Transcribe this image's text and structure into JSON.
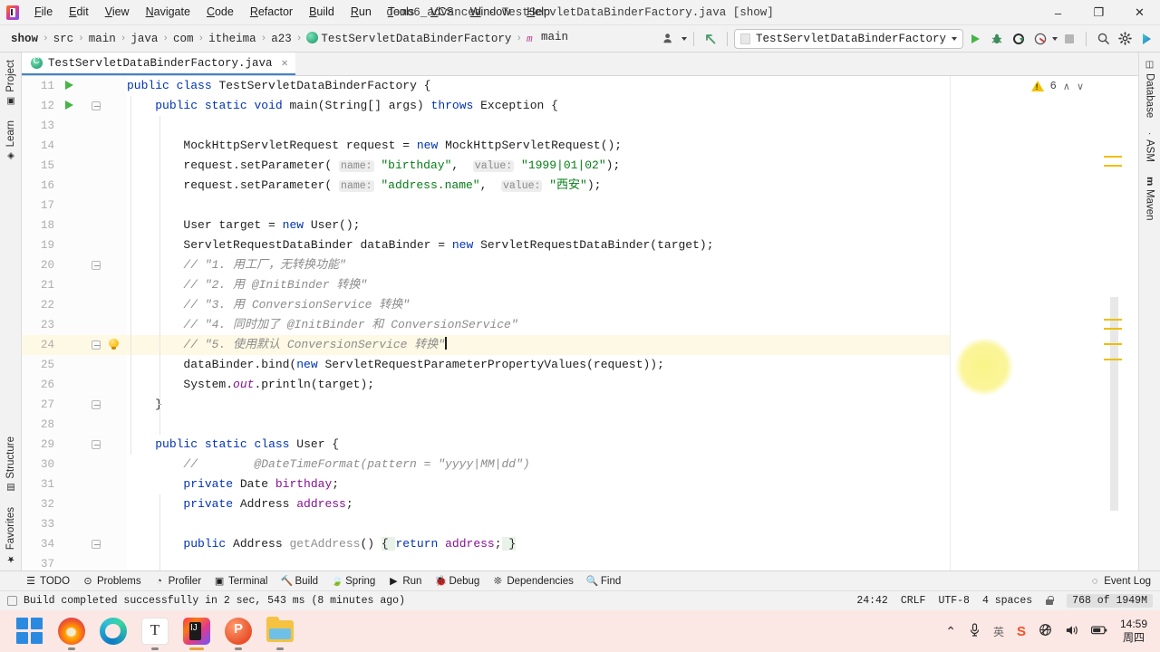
{
  "window": {
    "title": "demo6_advanced - TestServletDataBinderFactory.java [show]",
    "minimize_label": "–",
    "maximize_label": "❐",
    "close_label": "✕"
  },
  "menu": {
    "items": [
      {
        "label": "File"
      },
      {
        "label": "Edit"
      },
      {
        "label": "View"
      },
      {
        "label": "Navigate"
      },
      {
        "label": "Code"
      },
      {
        "label": "Refactor"
      },
      {
        "label": "Build"
      },
      {
        "label": "Run"
      },
      {
        "label": "Tools"
      },
      {
        "label": "VCS"
      },
      {
        "label": "Window"
      },
      {
        "label": "Help"
      }
    ]
  },
  "breadcrumb": {
    "items": [
      {
        "label": "show",
        "bold": true
      },
      {
        "label": "src",
        "bold": false
      },
      {
        "label": "main",
        "bold": false
      },
      {
        "label": "java",
        "bold": false
      },
      {
        "label": "com",
        "bold": false
      },
      {
        "label": "itheima",
        "bold": false
      },
      {
        "label": "a23",
        "bold": false
      },
      {
        "label": "TestServletDataBinderFactory",
        "bold": false
      },
      {
        "label": "main",
        "bold": false
      }
    ],
    "separator": "›"
  },
  "toolbar": {
    "run_config_label": "TestServletDataBinderFactory",
    "icons": {
      "profile_selector": "user-profile-icon",
      "updates": "arrow-up-left-icon",
      "run": "run-icon",
      "debug": "debug-icon",
      "run_coverage": "run-with-coverage-icon",
      "profiler": "profiler-icon",
      "stop": "stop-icon",
      "search_everywhere": "search-icon",
      "settings": "gear-icon",
      "ai_assistant": "ai-assistant-icon"
    }
  },
  "left_strip": {
    "top": [
      {
        "label": "Project",
        "icon": "project-icon"
      },
      {
        "label": "Learn",
        "icon": "learn-icon"
      }
    ],
    "bottom": [
      {
        "label": "Structure",
        "icon": "structure-icon"
      },
      {
        "label": "Favorites",
        "icon": "star-icon"
      }
    ]
  },
  "right_strip": {
    "items": [
      {
        "label": "Database",
        "icon": "database-icon"
      },
      {
        "label": "ASM",
        "icon": "asm-icon"
      },
      {
        "label": "Maven",
        "icon": "maven-icon"
      }
    ]
  },
  "editor_tab": {
    "filename": "TestServletDataBinderFactory.java",
    "close_label": "✕",
    "icon": "java-class-icon"
  },
  "inspections": {
    "warning_count": "6",
    "up_label": "∧",
    "down_label": "∨"
  },
  "code": {
    "first_line_number": 11,
    "lines": [
      {
        "n": 11,
        "indent": 0,
        "gutter": "run",
        "fold": false,
        "tokens": [
          {
            "t": "public",
            "c": "kw"
          },
          {
            "t": " ",
            "c": "plain"
          },
          {
            "t": "class",
            "c": "kw"
          },
          {
            "t": " TestServletDataBinderFactory {",
            "c": "plain"
          }
        ]
      },
      {
        "n": 12,
        "indent": 0,
        "gutter": "run",
        "fold": true,
        "tokens": [
          {
            "t": "    ",
            "c": "plain"
          },
          {
            "t": "public",
            "c": "kw"
          },
          {
            "t": " ",
            "c": "plain"
          },
          {
            "t": "static",
            "c": "kw"
          },
          {
            "t": " ",
            "c": "plain"
          },
          {
            "t": "void",
            "c": "kw"
          },
          {
            "t": " main(String[] args) ",
            "c": "plain"
          },
          {
            "t": "throws",
            "c": "kw"
          },
          {
            "t": " Exception {",
            "c": "plain"
          }
        ]
      },
      {
        "n": 13,
        "indent": 0,
        "gutter": "",
        "fold": false,
        "tokens": []
      },
      {
        "n": 14,
        "indent": 0,
        "gutter": "",
        "fold": false,
        "tokens": [
          {
            "t": "        MockHttpServletRequest request = ",
            "c": "plain"
          },
          {
            "t": "new",
            "c": "kw"
          },
          {
            "t": " MockHttpServletRequest();",
            "c": "plain"
          }
        ]
      },
      {
        "n": 15,
        "indent": 0,
        "gutter": "",
        "fold": false,
        "tokens": [
          {
            "t": "        request.setParameter( ",
            "c": "plain"
          },
          {
            "t": "name:",
            "c": "hint"
          },
          {
            "t": " ",
            "c": "plain"
          },
          {
            "t": "\"birthday\"",
            "c": "str"
          },
          {
            "t": ",  ",
            "c": "plain"
          },
          {
            "t": "value:",
            "c": "hint"
          },
          {
            "t": " ",
            "c": "plain"
          },
          {
            "t": "\"1999|01|02\"",
            "c": "str"
          },
          {
            "t": ");",
            "c": "plain"
          }
        ]
      },
      {
        "n": 16,
        "indent": 0,
        "gutter": "",
        "fold": false,
        "tokens": [
          {
            "t": "        request.setParameter( ",
            "c": "plain"
          },
          {
            "t": "name:",
            "c": "hint"
          },
          {
            "t": " ",
            "c": "plain"
          },
          {
            "t": "\"address.name\"",
            "c": "str"
          },
          {
            "t": ",  ",
            "c": "plain"
          },
          {
            "t": "value:",
            "c": "hint"
          },
          {
            "t": " ",
            "c": "plain"
          },
          {
            "t": "\"西安\"",
            "c": "str"
          },
          {
            "t": ");",
            "c": "plain"
          }
        ]
      },
      {
        "n": 17,
        "indent": 0,
        "gutter": "",
        "fold": false,
        "tokens": []
      },
      {
        "n": 18,
        "indent": 0,
        "gutter": "",
        "fold": false,
        "tokens": [
          {
            "t": "        User target = ",
            "c": "plain"
          },
          {
            "t": "new",
            "c": "kw"
          },
          {
            "t": " User();",
            "c": "plain"
          }
        ]
      },
      {
        "n": 19,
        "indent": 0,
        "gutter": "",
        "fold": false,
        "tokens": [
          {
            "t": "        ServletRequestDataBinder dataBinder = ",
            "c": "plain"
          },
          {
            "t": "new",
            "c": "kw"
          },
          {
            "t": " ServletRequestDataBinder(target);",
            "c": "plain"
          }
        ]
      },
      {
        "n": 20,
        "indent": 0,
        "gutter": "",
        "fold": true,
        "tokens": [
          {
            "t": "        // \"1. 用工厂，无转换功能\"",
            "c": "cmt"
          }
        ]
      },
      {
        "n": 21,
        "indent": 0,
        "gutter": "",
        "fold": false,
        "tokens": [
          {
            "t": "        // \"2. 用 @InitBinder 转换\"",
            "c": "cmt"
          }
        ]
      },
      {
        "n": 22,
        "indent": 0,
        "gutter": "",
        "fold": false,
        "tokens": [
          {
            "t": "        // \"3. 用 ConversionService 转换\"",
            "c": "cmt"
          }
        ]
      },
      {
        "n": 23,
        "indent": 0,
        "gutter": "",
        "fold": false,
        "tokens": [
          {
            "t": "        // \"4. 同时加了 @InitBinder 和 ConversionService\"",
            "c": "cmt"
          }
        ]
      },
      {
        "n": 24,
        "indent": 0,
        "gutter": "bulb",
        "fold": true,
        "highlight": true,
        "caret": true,
        "tokens": [
          {
            "t": "        // \"5. 使用默认 ConversionService 转换\"",
            "c": "cmt"
          }
        ]
      },
      {
        "n": 25,
        "indent": 0,
        "gutter": "",
        "fold": false,
        "tokens": [
          {
            "t": "        dataBinder.bind(",
            "c": "plain"
          },
          {
            "t": "new",
            "c": "kw"
          },
          {
            "t": " ServletRequestParameterPropertyValues(request));",
            "c": "plain"
          }
        ]
      },
      {
        "n": 26,
        "indent": 0,
        "gutter": "",
        "fold": false,
        "tokens": [
          {
            "t": "        System.",
            "c": "plain"
          },
          {
            "t": "out",
            "c": "stat"
          },
          {
            "t": ".println(target);",
            "c": "plain"
          }
        ]
      },
      {
        "n": 27,
        "indent": 0,
        "gutter": "",
        "fold": true,
        "tokens": [
          {
            "t": "    }",
            "c": "plain"
          }
        ]
      },
      {
        "n": 28,
        "indent": 0,
        "gutter": "",
        "fold": false,
        "tokens": []
      },
      {
        "n": 29,
        "indent": 0,
        "gutter": "",
        "fold": true,
        "tokens": [
          {
            "t": "    ",
            "c": "plain"
          },
          {
            "t": "public",
            "c": "kw"
          },
          {
            "t": " ",
            "c": "plain"
          },
          {
            "t": "static",
            "c": "kw"
          },
          {
            "t": " ",
            "c": "plain"
          },
          {
            "t": "class",
            "c": "kw"
          },
          {
            "t": " User {",
            "c": "plain"
          }
        ]
      },
      {
        "n": 30,
        "indent": 0,
        "gutter": "",
        "fold": false,
        "tokens": [
          {
            "t": "        //        @DateTimeFormat(pattern = \"yyyy|MM|dd\")",
            "c": "cmt"
          }
        ]
      },
      {
        "n": 31,
        "indent": 0,
        "gutter": "",
        "fold": false,
        "tokens": [
          {
            "t": "        ",
            "c": "plain"
          },
          {
            "t": "private",
            "c": "kw"
          },
          {
            "t": " Date ",
            "c": "plain"
          },
          {
            "t": "birthday",
            "c": "fld"
          },
          {
            "t": ";",
            "c": "plain"
          }
        ]
      },
      {
        "n": 32,
        "indent": 0,
        "gutter": "",
        "fold": false,
        "tokens": [
          {
            "t": "        ",
            "c": "plain"
          },
          {
            "t": "private",
            "c": "kw"
          },
          {
            "t": " Address ",
            "c": "plain"
          },
          {
            "t": "address",
            "c": "fld"
          },
          {
            "t": ";",
            "c": "plain"
          }
        ]
      },
      {
        "n": 33,
        "indent": 0,
        "gutter": "",
        "fold": false,
        "tokens": []
      },
      {
        "n": 34,
        "indent": 0,
        "gutter": "",
        "fold": true,
        "tokens": [
          {
            "t": "        ",
            "c": "plain"
          },
          {
            "t": "public",
            "c": "kw"
          },
          {
            "t": " Address ",
            "c": "plain"
          },
          {
            "t": "getAddress",
            "c": "mth"
          },
          {
            "t": "() ",
            "c": "plain"
          },
          {
            "t": "{ ",
            "c": "braceHL"
          },
          {
            "t": "return",
            "c": "kw"
          },
          {
            "t": " ",
            "c": "plain"
          },
          {
            "t": "address",
            "c": "fld"
          },
          {
            "t": ";",
            "c": "plain"
          },
          {
            "t": " }",
            "c": "braceHL"
          }
        ]
      },
      {
        "n": 37,
        "indent": 0,
        "gutter": "",
        "fold": false,
        "tokens": []
      }
    ]
  },
  "tool_windows": {
    "items": [
      {
        "label": "TODO",
        "icon": "todo-icon"
      },
      {
        "label": "Problems",
        "icon": "problems-icon"
      },
      {
        "label": "Profiler",
        "icon": "profiler-icon"
      },
      {
        "label": "Terminal",
        "icon": "terminal-icon"
      },
      {
        "label": "Build",
        "icon": "build-icon"
      },
      {
        "label": "Spring",
        "icon": "spring-icon"
      },
      {
        "label": "Run",
        "icon": "run-icon"
      },
      {
        "label": "Debug",
        "icon": "debug-icon"
      },
      {
        "label": "Dependencies",
        "icon": "dependencies-icon"
      },
      {
        "label": "Find",
        "icon": "search-icon"
      }
    ],
    "event_log": {
      "label": "Event Log",
      "icon": "event-log-icon"
    }
  },
  "statusbar": {
    "message": "Build completed successfully in 2 sec, 543 ms (8 minutes ago)",
    "caret_position": "24:42",
    "line_separator": "CRLF",
    "encoding": "UTF-8",
    "indent": "4 spaces",
    "lock_icon": "unlocked-icon",
    "memory": "768 of 1949M"
  },
  "taskbar": {
    "apps": [
      {
        "name": "start-button",
        "icon": "windows-start-icon",
        "state": "idle"
      },
      {
        "name": "firefox",
        "icon": "firefox-icon",
        "state": "open"
      },
      {
        "name": "edge",
        "icon": "edge-icon",
        "state": "idle"
      },
      {
        "name": "typora",
        "icon": "typora-icon",
        "state": "open"
      },
      {
        "name": "intellij-idea",
        "icon": "intellij-idea-icon",
        "state": "active"
      },
      {
        "name": "powerpoint",
        "icon": "powerpoint-icon",
        "state": "open"
      },
      {
        "name": "file-explorer",
        "icon": "file-explorer-icon",
        "state": "open"
      }
    ],
    "tray": {
      "show_hidden": "⌃",
      "microphone": "🎤",
      "ime": "英",
      "sogou": "S",
      "network": "🌐",
      "volume": "🔊",
      "battery": "🔋",
      "time": "14:59",
      "day": "周四"
    }
  },
  "colors": {
    "accent_blue": "#4083c9",
    "keyword": "#0033b3",
    "string": "#067d17",
    "field": "#871094",
    "comment": "#8c8c8c",
    "warning_yellow": "#f2c200",
    "run_green": "#45b545",
    "taskbar_bg": "#fbe7e4"
  }
}
